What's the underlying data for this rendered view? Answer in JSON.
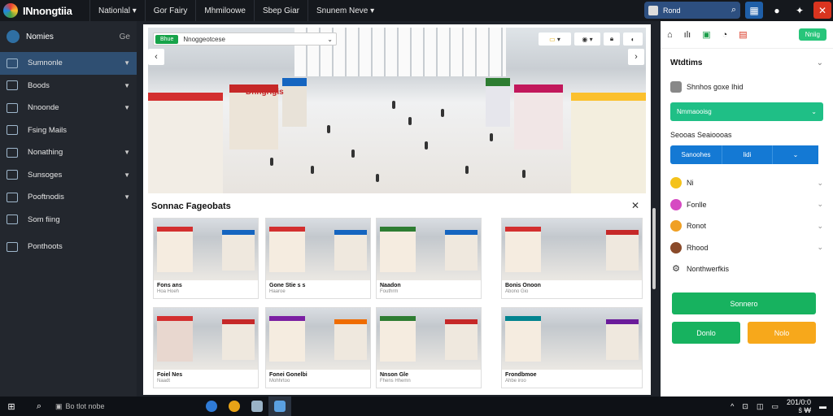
{
  "app": {
    "title": "INnongtiia"
  },
  "topnav": [
    "Nationlal ▾",
    "Gor Fairy",
    "Mhmiloowe",
    "Sbep Giar",
    "Snunem Neve ▾"
  ],
  "search": {
    "label": "Rond"
  },
  "sidebar": {
    "header": "Nomies",
    "header_right": "Ge",
    "items": [
      {
        "label": "Sumnonle",
        "active": true,
        "chevron": true
      },
      {
        "label": "Boods",
        "chevron": true
      },
      {
        "label": "Nnoonde",
        "chevron": true
      },
      {
        "label": "Fsing Mails",
        "chevron": false
      },
      {
        "label": "Nonathing",
        "chevron": true
      },
      {
        "label": "Sunsoges",
        "chevron": true
      },
      {
        "label": "Pooftnodis",
        "chevron": true
      },
      {
        "label": "Som fiing",
        "chevron": false
      },
      {
        "label": "Ponthoots",
        "chevron": false
      }
    ]
  },
  "hero": {
    "tag": "Bhue",
    "location": "Nnoggeotcese",
    "sign": "Dhngrigis"
  },
  "related": {
    "title": "Sonnac Fageobats",
    "cards": [
      {
        "caption": "Fons ans",
        "sub": "Hoa Hoeh"
      },
      {
        "caption": "Gone Stie s s",
        "sub": "Haaroe"
      },
      {
        "caption": "Naadon",
        "sub": "Fouthrm"
      },
      {
        "caption": "Bonis Onoon",
        "sub": "Abono Gio"
      },
      {
        "caption": "Foiel Nes",
        "sub": "Naadt"
      },
      {
        "caption": "Fonei Gonelbi",
        "sub": "Mohhrtoo"
      },
      {
        "caption": "Nnson Gle",
        "sub": "Fhens Hhemn"
      },
      {
        "caption": "Frondbmoe",
        "sub": "Ahbe iroo"
      }
    ]
  },
  "right": {
    "toolbar_btn": "Nniig",
    "section_title": "Wtdtims",
    "user": "Shnhos goxe Ihid",
    "select1": "Nmmaooisg",
    "subhead": "Seooas Seaioooas",
    "seg": [
      "Sanoohes",
      "lidi",
      ""
    ],
    "options": [
      {
        "label": "Ni",
        "color": "#f4c21b"
      },
      {
        "label": "Fonlle",
        "color": "#d64ac2"
      },
      {
        "label": "Ronot",
        "color": "#f0a024"
      },
      {
        "label": "Rhood",
        "color": "#8a4a2a"
      },
      {
        "label": "Nonthwerfkis",
        "color": "#555555"
      }
    ],
    "btn_primary": "Sonnero",
    "btn_left": "Donlo",
    "btn_right": "Nolo"
  },
  "taskbar": {
    "search": "Bo tlot nobe",
    "time": "201/0:0",
    "date": "ŝ ₩"
  },
  "colors": {
    "accent_green": "#1fbf86",
    "accent_blue": "#1479d4",
    "accent_orange": "#f7a81b",
    "sidebar_active": "#2f4f72"
  }
}
